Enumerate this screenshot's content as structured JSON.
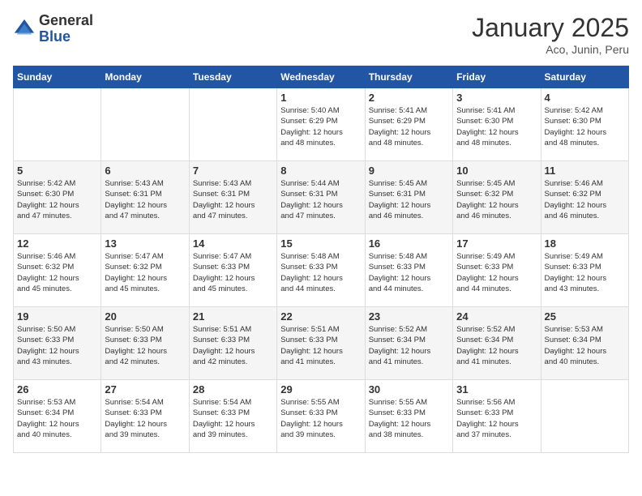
{
  "header": {
    "logo_general": "General",
    "logo_blue": "Blue",
    "title": "January 2025",
    "subtitle": "Aco, Junin, Peru"
  },
  "weekdays": [
    "Sunday",
    "Monday",
    "Tuesday",
    "Wednesday",
    "Thursday",
    "Friday",
    "Saturday"
  ],
  "weeks": [
    [
      {
        "day": "",
        "info": ""
      },
      {
        "day": "",
        "info": ""
      },
      {
        "day": "",
        "info": ""
      },
      {
        "day": "1",
        "info": "Sunrise: 5:40 AM\nSunset: 6:29 PM\nDaylight: 12 hours\nand 48 minutes."
      },
      {
        "day": "2",
        "info": "Sunrise: 5:41 AM\nSunset: 6:29 PM\nDaylight: 12 hours\nand 48 minutes."
      },
      {
        "day": "3",
        "info": "Sunrise: 5:41 AM\nSunset: 6:30 PM\nDaylight: 12 hours\nand 48 minutes."
      },
      {
        "day": "4",
        "info": "Sunrise: 5:42 AM\nSunset: 6:30 PM\nDaylight: 12 hours\nand 48 minutes."
      }
    ],
    [
      {
        "day": "5",
        "info": "Sunrise: 5:42 AM\nSunset: 6:30 PM\nDaylight: 12 hours\nand 47 minutes."
      },
      {
        "day": "6",
        "info": "Sunrise: 5:43 AM\nSunset: 6:31 PM\nDaylight: 12 hours\nand 47 minutes."
      },
      {
        "day": "7",
        "info": "Sunrise: 5:43 AM\nSunset: 6:31 PM\nDaylight: 12 hours\nand 47 minutes."
      },
      {
        "day": "8",
        "info": "Sunrise: 5:44 AM\nSunset: 6:31 PM\nDaylight: 12 hours\nand 47 minutes."
      },
      {
        "day": "9",
        "info": "Sunrise: 5:45 AM\nSunset: 6:31 PM\nDaylight: 12 hours\nand 46 minutes."
      },
      {
        "day": "10",
        "info": "Sunrise: 5:45 AM\nSunset: 6:32 PM\nDaylight: 12 hours\nand 46 minutes."
      },
      {
        "day": "11",
        "info": "Sunrise: 5:46 AM\nSunset: 6:32 PM\nDaylight: 12 hours\nand 46 minutes."
      }
    ],
    [
      {
        "day": "12",
        "info": "Sunrise: 5:46 AM\nSunset: 6:32 PM\nDaylight: 12 hours\nand 45 minutes."
      },
      {
        "day": "13",
        "info": "Sunrise: 5:47 AM\nSunset: 6:32 PM\nDaylight: 12 hours\nand 45 minutes."
      },
      {
        "day": "14",
        "info": "Sunrise: 5:47 AM\nSunset: 6:33 PM\nDaylight: 12 hours\nand 45 minutes."
      },
      {
        "day": "15",
        "info": "Sunrise: 5:48 AM\nSunset: 6:33 PM\nDaylight: 12 hours\nand 44 minutes."
      },
      {
        "day": "16",
        "info": "Sunrise: 5:48 AM\nSunset: 6:33 PM\nDaylight: 12 hours\nand 44 minutes."
      },
      {
        "day": "17",
        "info": "Sunrise: 5:49 AM\nSunset: 6:33 PM\nDaylight: 12 hours\nand 44 minutes."
      },
      {
        "day": "18",
        "info": "Sunrise: 5:49 AM\nSunset: 6:33 PM\nDaylight: 12 hours\nand 43 minutes."
      }
    ],
    [
      {
        "day": "19",
        "info": "Sunrise: 5:50 AM\nSunset: 6:33 PM\nDaylight: 12 hours\nand 43 minutes."
      },
      {
        "day": "20",
        "info": "Sunrise: 5:50 AM\nSunset: 6:33 PM\nDaylight: 12 hours\nand 42 minutes."
      },
      {
        "day": "21",
        "info": "Sunrise: 5:51 AM\nSunset: 6:33 PM\nDaylight: 12 hours\nand 42 minutes."
      },
      {
        "day": "22",
        "info": "Sunrise: 5:51 AM\nSunset: 6:33 PM\nDaylight: 12 hours\nand 41 minutes."
      },
      {
        "day": "23",
        "info": "Sunrise: 5:52 AM\nSunset: 6:34 PM\nDaylight: 12 hours\nand 41 minutes."
      },
      {
        "day": "24",
        "info": "Sunrise: 5:52 AM\nSunset: 6:34 PM\nDaylight: 12 hours\nand 41 minutes."
      },
      {
        "day": "25",
        "info": "Sunrise: 5:53 AM\nSunset: 6:34 PM\nDaylight: 12 hours\nand 40 minutes."
      }
    ],
    [
      {
        "day": "26",
        "info": "Sunrise: 5:53 AM\nSunset: 6:34 PM\nDaylight: 12 hours\nand 40 minutes."
      },
      {
        "day": "27",
        "info": "Sunrise: 5:54 AM\nSunset: 6:33 PM\nDaylight: 12 hours\nand 39 minutes."
      },
      {
        "day": "28",
        "info": "Sunrise: 5:54 AM\nSunset: 6:33 PM\nDaylight: 12 hours\nand 39 minutes."
      },
      {
        "day": "29",
        "info": "Sunrise: 5:55 AM\nSunset: 6:33 PM\nDaylight: 12 hours\nand 39 minutes."
      },
      {
        "day": "30",
        "info": "Sunrise: 5:55 AM\nSunset: 6:33 PM\nDaylight: 12 hours\nand 38 minutes."
      },
      {
        "day": "31",
        "info": "Sunrise: 5:56 AM\nSunset: 6:33 PM\nDaylight: 12 hours\nand 37 minutes."
      },
      {
        "day": "",
        "info": ""
      }
    ]
  ]
}
